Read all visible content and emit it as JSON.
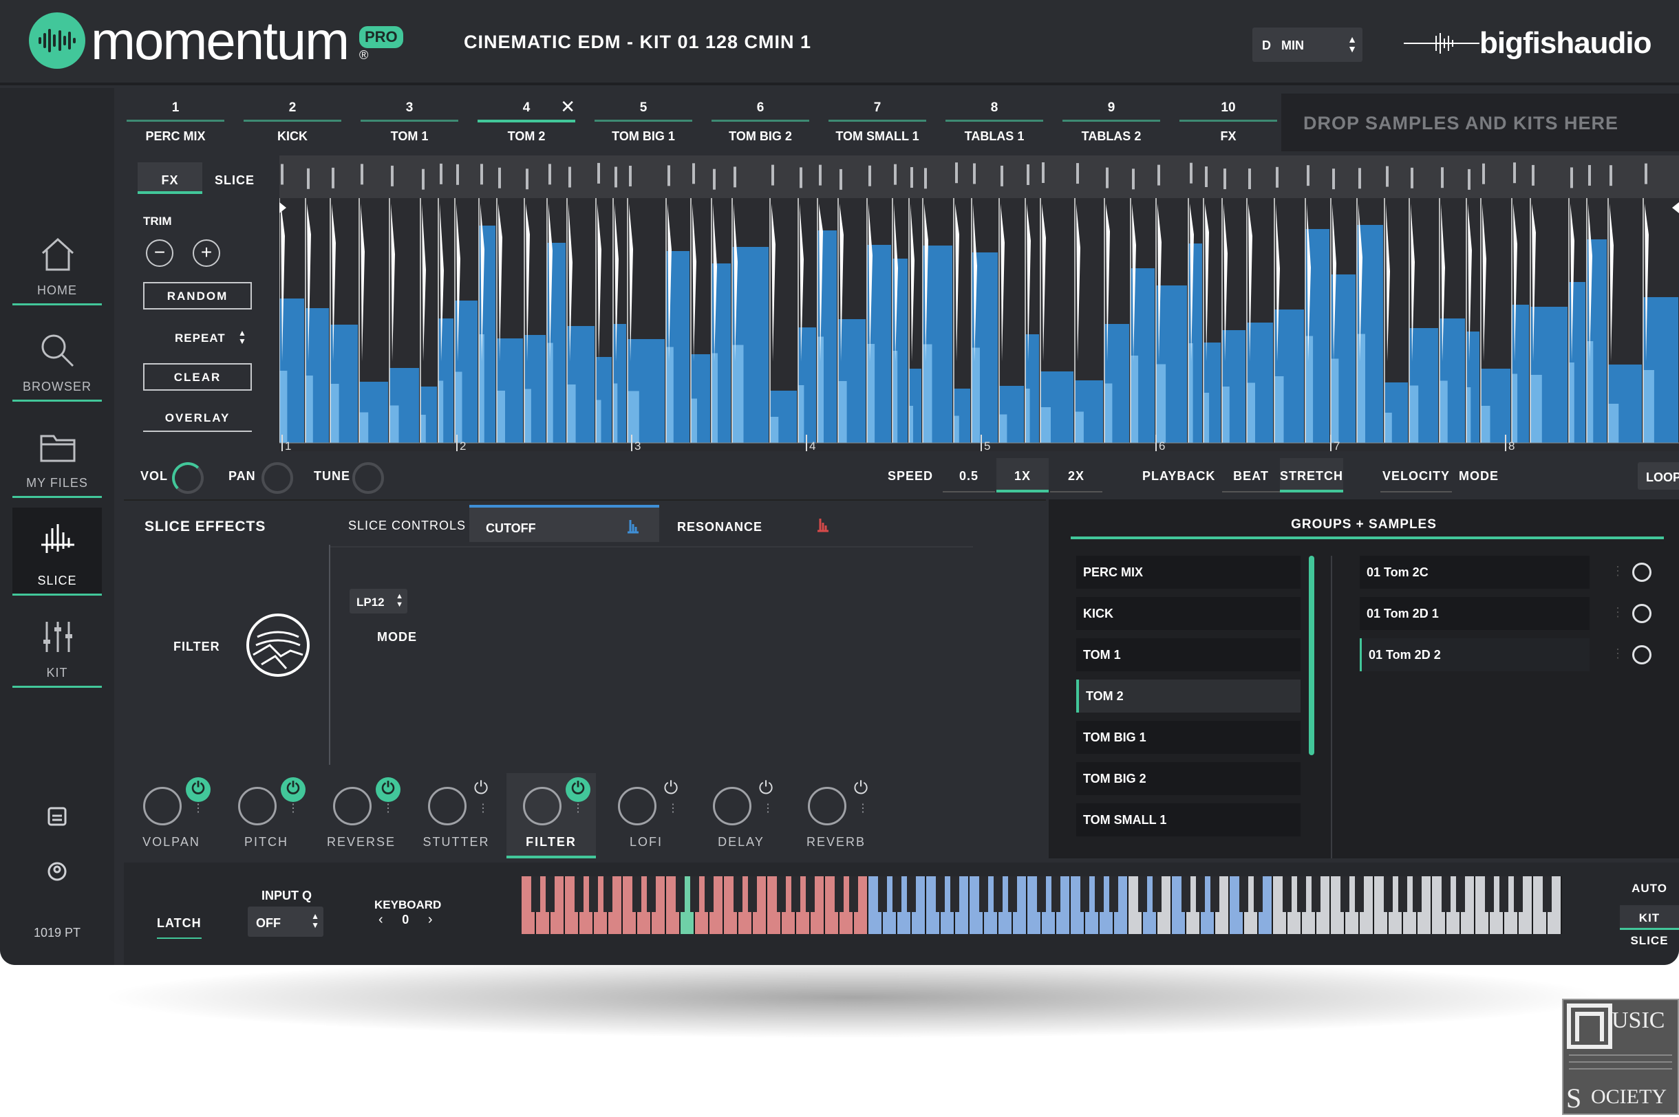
{
  "app": {
    "name": "momentum",
    "badge": "PRO",
    "reg": "®",
    "kit_title": "CINEMATIC EDM - KIT 01 128 CMIN 1",
    "key": "D",
    "scale": "MIN",
    "vendor": "bigfishaudio"
  },
  "nav": [
    {
      "label": "HOME"
    },
    {
      "label": "BROWSER"
    },
    {
      "label": "MY FILES"
    },
    {
      "label": "SLICE"
    },
    {
      "label": "KIT"
    }
  ],
  "points": "1019 PT",
  "kit_tabs": [
    {
      "num": "1",
      "name": "PERC MIX"
    },
    {
      "num": "2",
      "name": "KICK"
    },
    {
      "num": "3",
      "name": "TOM 1"
    },
    {
      "num": "4",
      "name": "TOM 2"
    },
    {
      "num": "5",
      "name": "TOM BIG 1"
    },
    {
      "num": "6",
      "name": "TOM BIG 2"
    },
    {
      "num": "7",
      "name": "TOM SMALL 1"
    },
    {
      "num": "8",
      "name": "TABLAS 1"
    },
    {
      "num": "9",
      "name": "TABLAS 2"
    },
    {
      "num": "10",
      "name": "FX"
    }
  ],
  "drop_text": "DROP SAMPLES AND KITS HERE",
  "left_panel": {
    "tab_fx": "FX",
    "tab_slice": "SLICE",
    "trim": "TRIM",
    "random": "RANDOM",
    "repeat": "REPEAT",
    "clear": "CLEAR",
    "overlay": "OVERLAY"
  },
  "bar_markers": [
    "1",
    "2",
    "3",
    "4",
    "5",
    "6",
    "7",
    "8"
  ],
  "controls": {
    "vol": "VOL",
    "pan": "PAN",
    "tune": "TUNE",
    "speed": "SPEED",
    "speed_opts": [
      "0.5",
      "1X",
      "2X"
    ],
    "playback": "PLAYBACK",
    "beat": "BEAT",
    "stretch": "STRETCH",
    "velocity": "VELOCITY",
    "mode": "MODE",
    "mode_value": "LOOP"
  },
  "effects": {
    "title": "SLICE EFFECTS",
    "tab_controls": "SLICE CONTROLS",
    "tab_cutoff": "CUTOFF",
    "tab_resonance": "RESONANCE",
    "filter_label": "FILTER",
    "filter_type": "LP12",
    "mode_label": "MODE",
    "icons": [
      {
        "label": "VOLPAN",
        "on": true
      },
      {
        "label": "PITCH",
        "on": true
      },
      {
        "label": "REVERSE",
        "on": true
      },
      {
        "label": "STUTTER",
        "on": false
      },
      {
        "label": "FILTER",
        "on": true
      },
      {
        "label": "LOFI",
        "on": false
      },
      {
        "label": "DELAY",
        "on": false
      },
      {
        "label": "REVERB",
        "on": false
      }
    ]
  },
  "groups": {
    "title": "GROUPS + SAMPLES",
    "items": [
      "PERC MIX",
      "KICK",
      "TOM 1",
      "TOM 2",
      "TOM BIG 1",
      "TOM BIG 2",
      "TOM SMALL 1"
    ],
    "samples": [
      "01 Tom 2C",
      "01 Tom 2D 1",
      "01 Tom 2D 2"
    ]
  },
  "bottom": {
    "latch": "LATCH",
    "input_q": "INPUT Q",
    "input_q_value": "OFF",
    "keyboard": "KEYBOARD",
    "keyboard_value": "0",
    "auto": "AUTO",
    "kit": "KIT",
    "slice": "SLICE"
  },
  "colors": {
    "accent": "#42c79a",
    "wave_blue": "#2f7fc1",
    "key_red": "#d98585",
    "key_blue": "#8aaee0",
    "key_green": "#6fd0a8"
  },
  "watermark": "MUSIC SOCIETY"
}
